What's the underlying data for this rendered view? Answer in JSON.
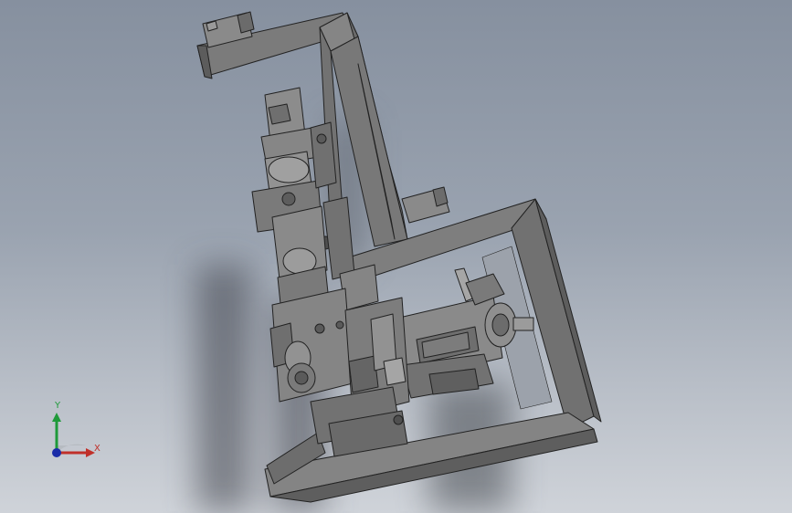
{
  "viewport": {
    "background_top": "#86909f",
    "background_bottom": "#cfd3d9",
    "model_color": "#7d7d7d",
    "edge_color": "#222222"
  },
  "triad": {
    "y_label": "Y",
    "x_label": "X",
    "y_color": "#1f9a3a",
    "x_color": "#c0302a",
    "z_color": "#1a2ca8"
  }
}
